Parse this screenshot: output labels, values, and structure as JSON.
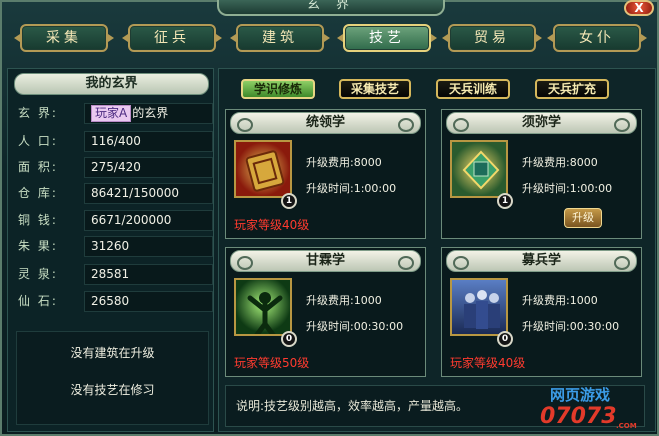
{
  "window": {
    "title": "玄 界",
    "close_label": "X"
  },
  "nav": {
    "items": [
      {
        "label": "采集"
      },
      {
        "label": "征兵"
      },
      {
        "label": "建筑"
      },
      {
        "label": "技艺",
        "active": true
      },
      {
        "label": "贸易"
      },
      {
        "label": "女仆"
      }
    ]
  },
  "left_panel": {
    "title": "我的玄界",
    "realm": {
      "label": "玄 界:",
      "player": "玩家A",
      "suffix": "的玄界"
    },
    "stats": [
      {
        "label": "人 口:",
        "value": "116/400"
      },
      {
        "label": "面 积:",
        "value": "275/420"
      },
      {
        "label": "仓 库:",
        "value": "86421/150000"
      },
      {
        "label": "铜 钱:",
        "value": "6671/200000"
      },
      {
        "label": "朱 果:",
        "value": "31260"
      },
      {
        "label": "灵 泉:",
        "value": "28581"
      },
      {
        "label": "仙 石:",
        "value": "26580"
      }
    ],
    "messages": [
      "没有建筑在升级",
      "没有技艺在修习"
    ]
  },
  "tabs": [
    {
      "label": "学识修炼",
      "active": true
    },
    {
      "label": "采集技艺"
    },
    {
      "label": "天兵训练"
    },
    {
      "label": "天兵扩充"
    }
  ],
  "skills": [
    {
      "name": "统领学",
      "cost_label": "升级费用:",
      "cost": "8000",
      "time_label": "升级时间:",
      "time": "1:00:00",
      "level": "1",
      "requirement": "玩家等级40级",
      "icon": "seal-icon"
    },
    {
      "name": "须弥学",
      "cost_label": "升级费用:",
      "cost": "8000",
      "time_label": "升级时间:",
      "time": "1:00:00",
      "level": "1",
      "upgrade_label": "升级",
      "icon": "palace-icon"
    },
    {
      "name": "甘霖学",
      "cost_label": "升级费用:",
      "cost": "1000",
      "time_label": "升级时间:",
      "time": "00:30:00",
      "level": "0",
      "requirement": "玩家等级50级",
      "icon": "figure-icon"
    },
    {
      "name": "募兵学",
      "cost_label": "升级费用:",
      "cost": "1000",
      "time_label": "升级时间:",
      "time": "00:30:00",
      "level": "0",
      "requirement": "玩家等级40级",
      "icon": "soldiers-icon"
    }
  ],
  "footer_note": "说明:技艺级别越高，效率越高，产量越高。",
  "watermark": {
    "line1": "网页游戏",
    "line2": "07073",
    "line3": ".COM"
  }
}
